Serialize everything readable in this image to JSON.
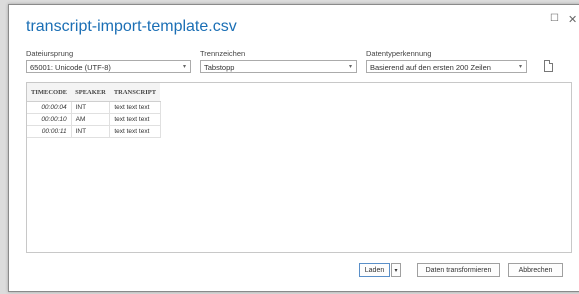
{
  "window": {
    "maximize_icon": "maximize-icon",
    "close_icon": "close-icon",
    "maximize_glyph": "☐",
    "close_glyph": "✕"
  },
  "title": "transcript-import-template.csv",
  "options": {
    "file_origin": {
      "label": "Dateiursprung",
      "value": "65001: Unicode (UTF-8)"
    },
    "delimiter": {
      "label": "Trennzeichen",
      "value": "Tabstopp"
    },
    "type_detection": {
      "label": "Datentyperkennung",
      "value": "Basierend auf den ersten 200 Zeilen"
    },
    "dropdown_glyph": "▾",
    "file_icon": "file-icon"
  },
  "preview": {
    "columns": [
      "TIMECODE",
      "SPEAKER",
      "TRANSCRIPT"
    ],
    "rows": [
      [
        "00:00:04",
        "INT",
        "text text text"
      ],
      [
        "00:00:10",
        "AM",
        "text text text"
      ],
      [
        "00:00:11",
        "INT",
        "text text text"
      ]
    ]
  },
  "buttons": {
    "load": "Laden",
    "load_dropdown": "▾",
    "transform": "Daten transformieren",
    "cancel": "Abbrechen"
  },
  "colors": {
    "title": "#1b6fb5",
    "primary_border": "#5a8fc8"
  }
}
